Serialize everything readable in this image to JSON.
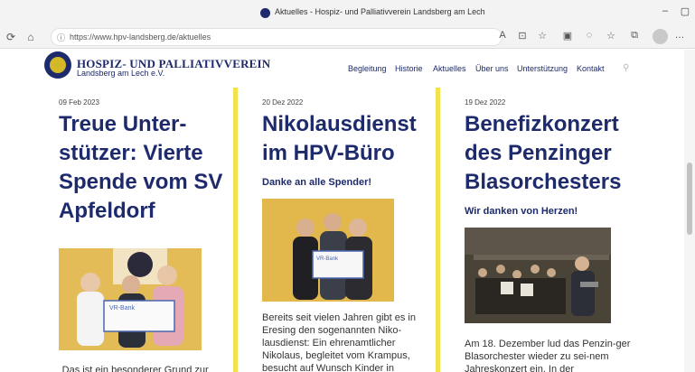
{
  "browser": {
    "tab_title": "Aktuelles - Hospiz- und Palliativverein Landsberg am Lech",
    "url": "https://www.hpv-landsberg.de/aktuelles",
    "window_controls": [
      "–",
      "▢"
    ],
    "nav_buttons": [
      "⟳",
      "⌂"
    ],
    "toolbar_icons": [
      "A",
      "⊡",
      "☆",
      "▣",
      "◌",
      "☆",
      "⧉",
      "…"
    ]
  },
  "site": {
    "brand_line1": "HOSPIZ- UND PALLIATIVVEREIN",
    "brand_line2": "Landsberg am Lech e.V.",
    "nav": [
      "Begleitung",
      "Historie",
      "Aktuelles",
      "Über uns",
      "Unterstützung",
      "Kontakt"
    ],
    "search_glyph": "⚲",
    "accent_color": "#f3e24b",
    "brand_color": "#1d2a6b"
  },
  "articles": [
    {
      "date": "09 Feb 2023",
      "title": "Treue Unter-stützer: Vierte Spende vom SV Apfeldorf",
      "excerpt": "„Das ist ein besonderer Grund zur Freude, wenn man so treue",
      "photo_caption": "VR-Bank"
    },
    {
      "date": "20 Dez 2022",
      "title": "Nikolausdienst im HPV-Büro",
      "subtitle": "Danke an alle Spender!",
      "excerpt": "Bereits seit vielen Jahren gibt es in Eresing den sogenannten Niko-lausdienst: Ein ehrenamtlicher Nikolaus, begleitet vom Krampus, besucht auf Wunsch Kinder in",
      "photo_caption": "VR-Bank"
    },
    {
      "date": "19 Dez 2022",
      "title": "Benefizkonzert des Penzinger Blasorchesters",
      "subtitle": "Wir danken von Herzen!",
      "excerpt": "Am 18. Dezember lud das Penzin-ger Blasorchester wieder zu sei-nem Jahreskonzert ein. In der"
    }
  ]
}
